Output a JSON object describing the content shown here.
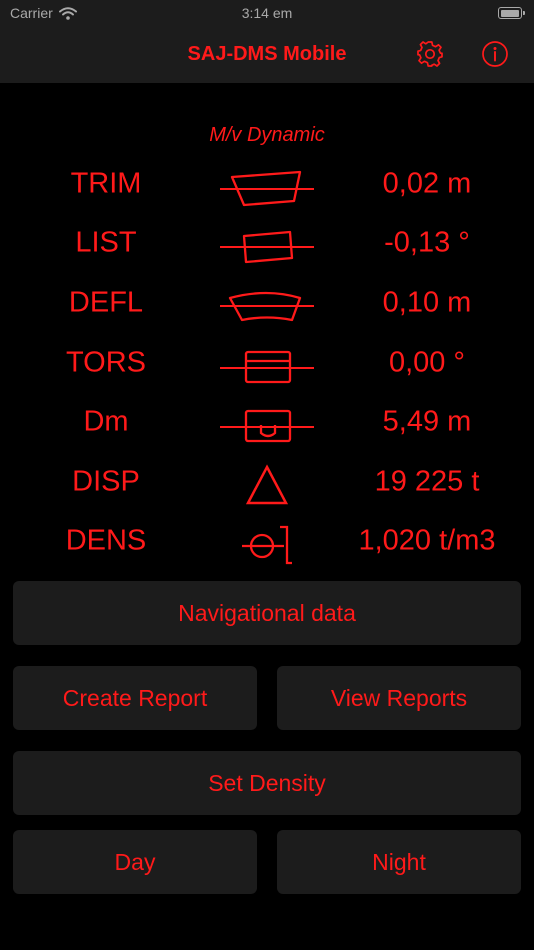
{
  "status_bar": {
    "carrier": "Carrier",
    "time": "3:14 em",
    "battery_level": 0.95,
    "wifi_icon": "wifi-icon",
    "battery_icon": "battery-icon"
  },
  "nav": {
    "title": "SAJ-DMS Mobile",
    "settings_icon": "gear-icon",
    "info_icon": "info-icon"
  },
  "subtitle": "M/v Dynamic",
  "rows": [
    {
      "label": "TRIM",
      "value": "0,02 m",
      "icon": "trim-icon"
    },
    {
      "label": "LIST",
      "value": "-0,13 °",
      "icon": "list-icon"
    },
    {
      "label": "DEFL",
      "value": "0,10 m",
      "icon": "deflection-icon"
    },
    {
      "label": "TORS",
      "value": "0,00 °",
      "icon": "torsion-icon"
    },
    {
      "label": "Dm",
      "value": "5,49 m",
      "icon": "mean-draft-icon"
    },
    {
      "label": "DISP",
      "value": "19 225 t",
      "icon": "displacement-icon"
    },
    {
      "label": "DENS",
      "value": "1,020 t/m3",
      "icon": "density-icon"
    }
  ],
  "buttons": {
    "navigational_data": "Navigational data",
    "create_report": "Create Report",
    "view_reports": "View Reports",
    "set_density": "Set Density",
    "day": "Day",
    "night": "Night"
  },
  "colors": {
    "accent": "#ff1a1a",
    "background": "#000000",
    "surface": "#1c1c1c",
    "status_text": "#a9a9a9"
  }
}
